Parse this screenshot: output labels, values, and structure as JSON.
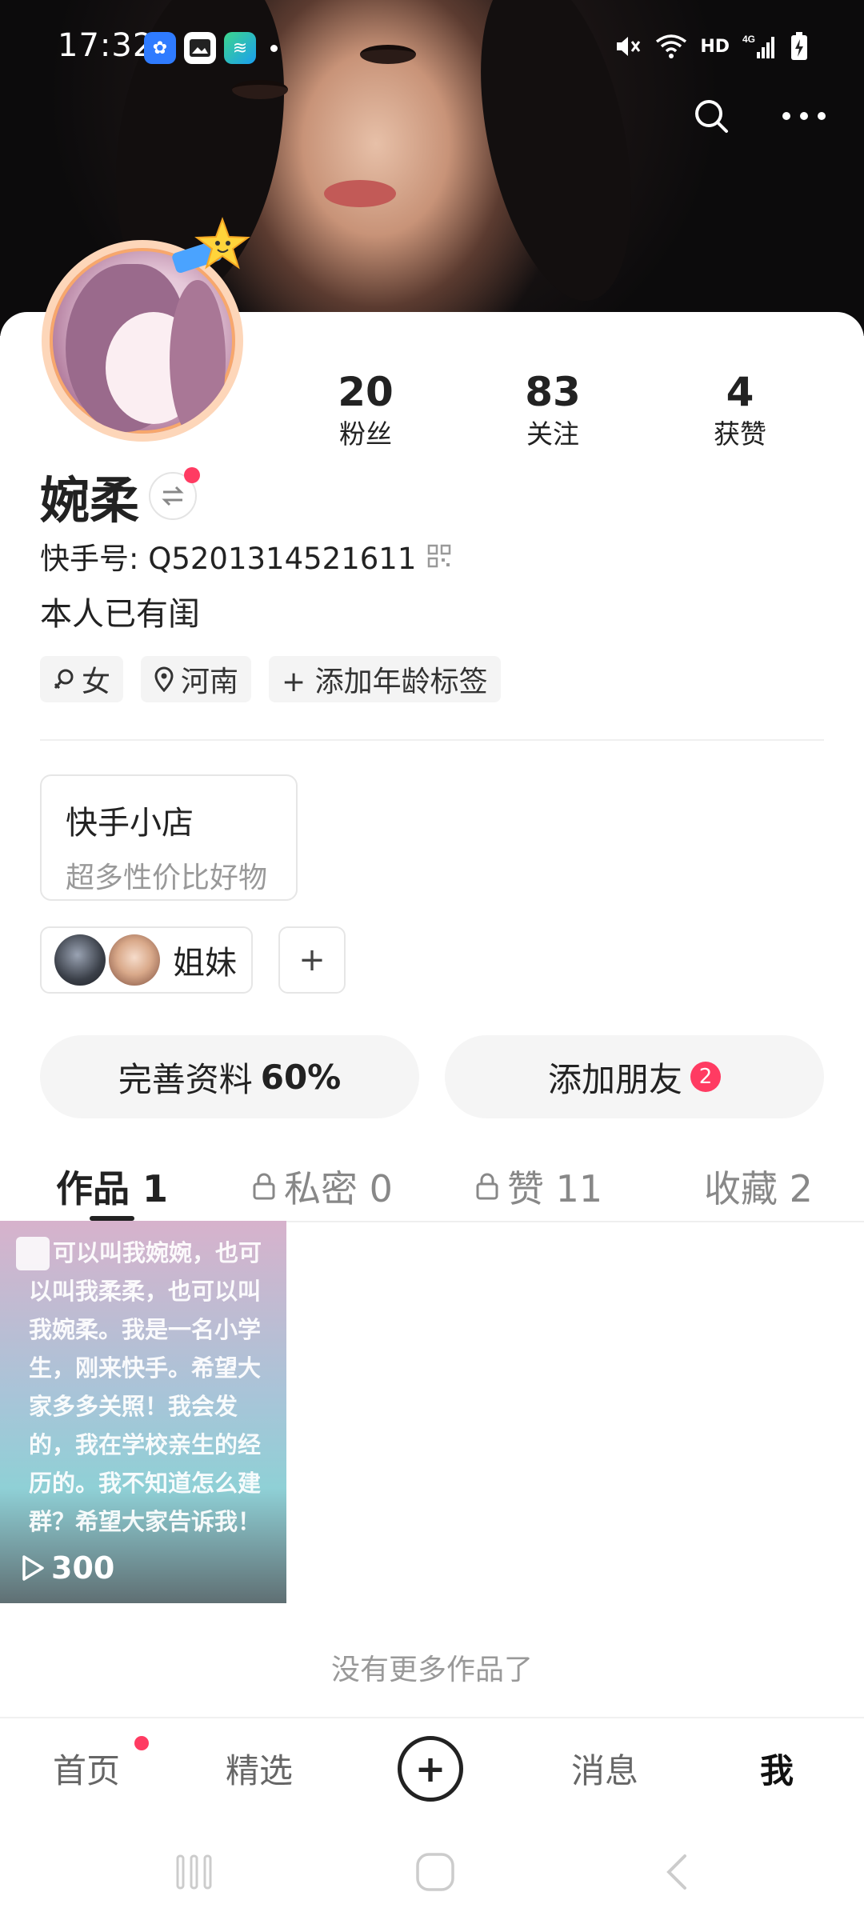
{
  "status_bar": {
    "time": "17:32",
    "hd_label": "HD",
    "network_label": "4G"
  },
  "profile": {
    "name": "婉柔",
    "kuaishou_id_label": "快手号: Q5201314521611",
    "bio": "本人已有闺",
    "stats": [
      {
        "value": "20",
        "label": "粉丝"
      },
      {
        "value": "83",
        "label": "关注"
      },
      {
        "value": "4",
        "label": "获赞"
      }
    ],
    "tags": [
      {
        "icon": "gender-icon",
        "label": "女"
      },
      {
        "icon": "location-pin-icon",
        "label": "河南"
      },
      {
        "icon": "plus-icon",
        "label": "+ 添加年龄标签"
      }
    ]
  },
  "shop": {
    "title": "快手小店",
    "subtitle": "超多性价比好物"
  },
  "group": {
    "label": "姐妹",
    "add_label": "+"
  },
  "actions": {
    "complete_profile": {
      "label": "完善资料",
      "percent": "60%"
    },
    "add_friends": {
      "label": "添加朋友",
      "badge": "2"
    }
  },
  "tabs": [
    {
      "label": "作品 1",
      "locked": false,
      "active": true
    },
    {
      "label": "私密 0",
      "locked": true,
      "active": false
    },
    {
      "label": "赞 11",
      "locked": true,
      "active": false
    },
    {
      "label": "收藏 2",
      "locked": false,
      "active": false
    }
  ],
  "works": [
    {
      "caption": "可以叫我婉婉，也可以叫我柔柔，也可以叫我婉柔。我是一名小学生，刚来快手。希望大家多多关照！我会发的，我在学校亲生的经历的。我不知道怎么建群？希望大家告诉我！",
      "plays": "300"
    }
  ],
  "no_more_text": "没有更多作品了",
  "bottom_nav": [
    {
      "label": "首页",
      "active": false,
      "has_dot": true
    },
    {
      "label": "精选",
      "active": false
    },
    {
      "label": "+",
      "active": false
    },
    {
      "label": "消息",
      "active": false
    },
    {
      "label": "我",
      "active": true
    }
  ],
  "colors": {
    "accent": "#ff3b62",
    "text": "#222222",
    "muted": "#999999"
  }
}
